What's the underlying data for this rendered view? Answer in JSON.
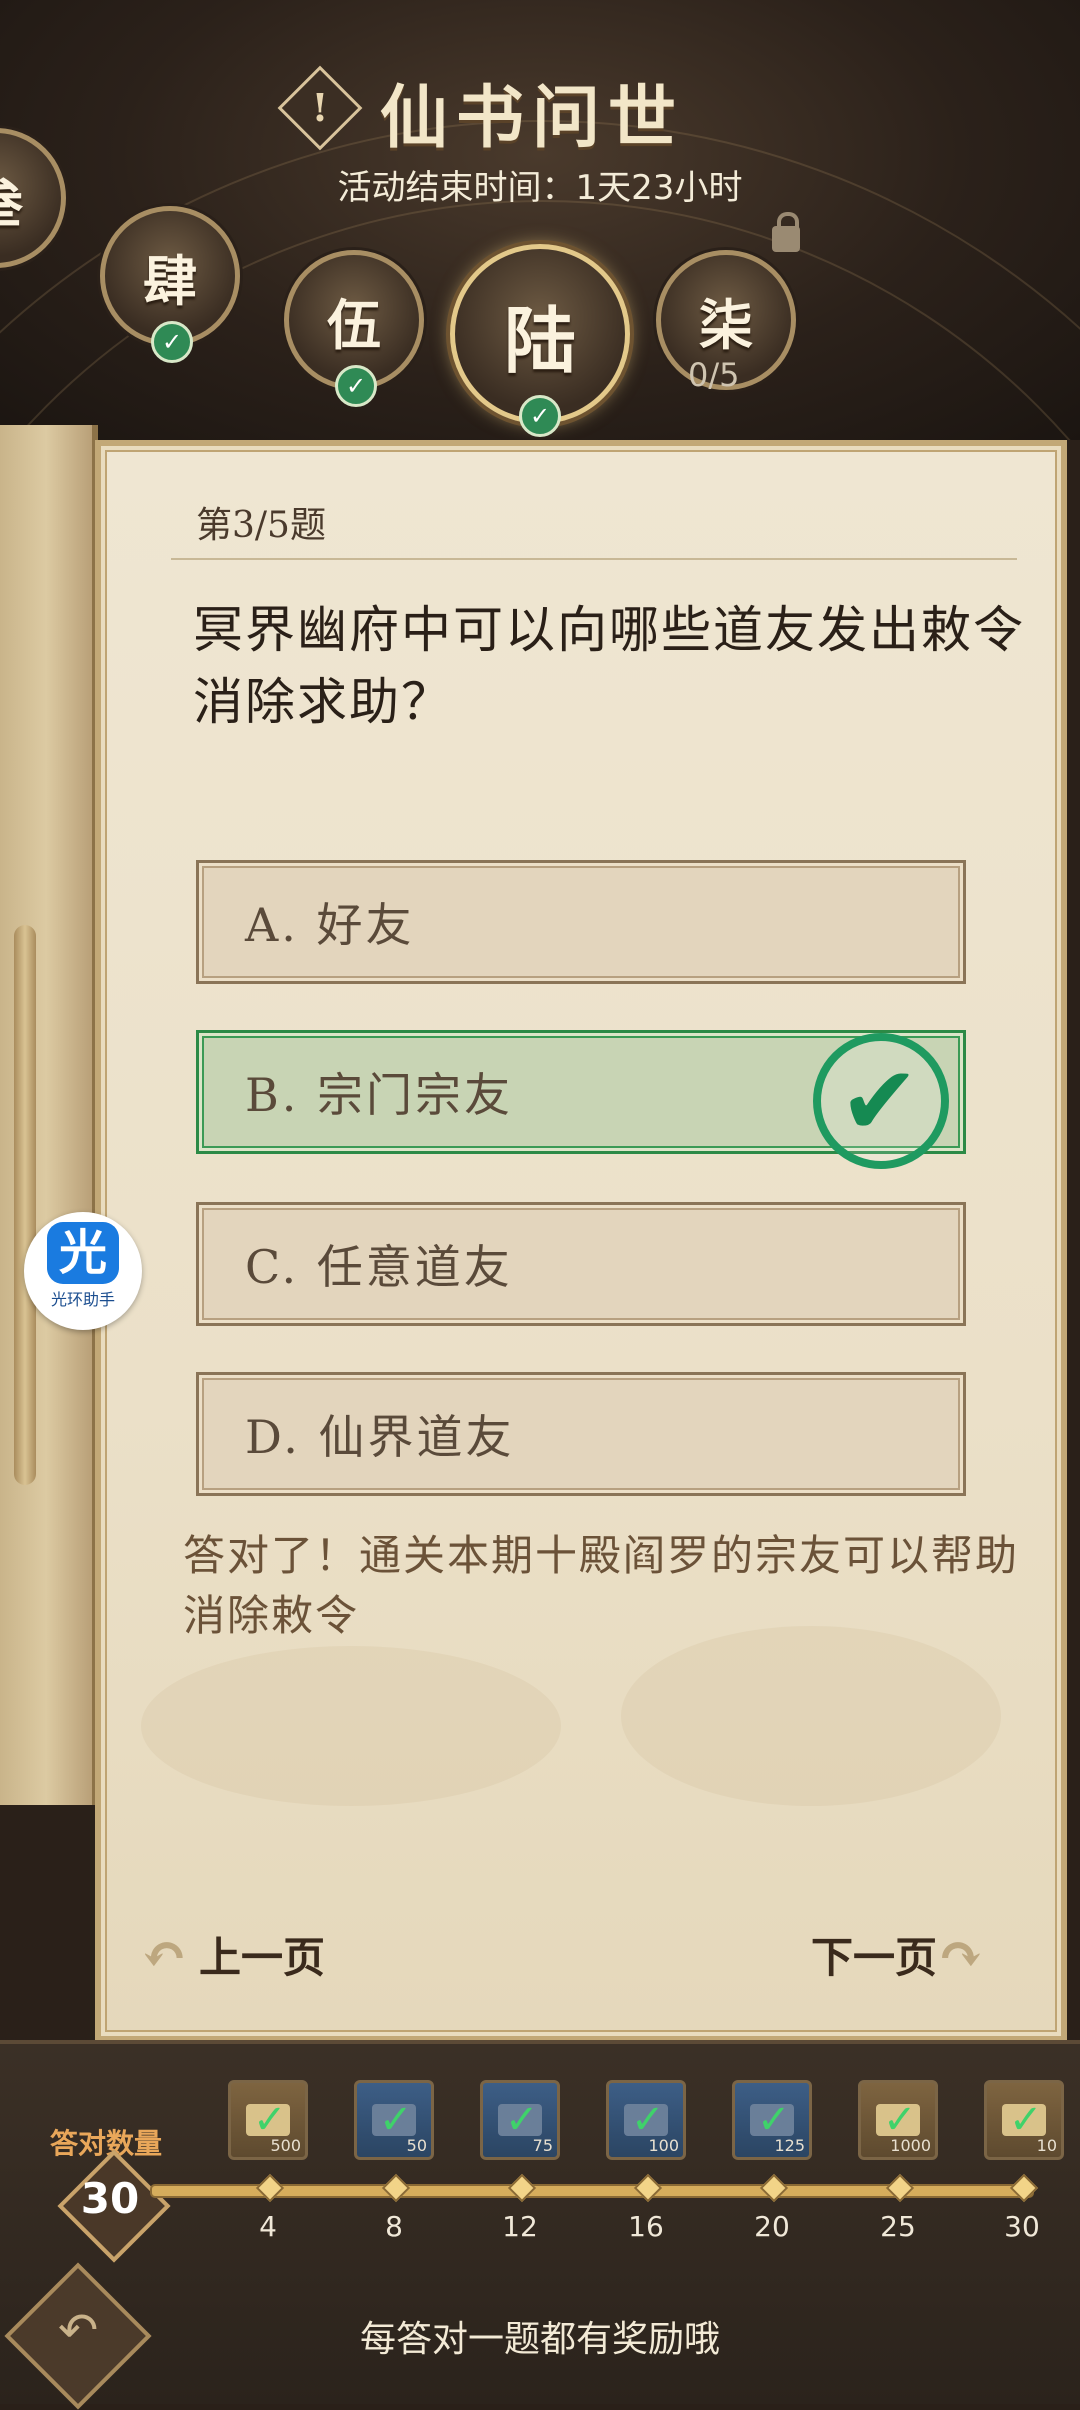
{
  "header": {
    "title": "仙书问世",
    "end_time_label": "活动结束时间：",
    "end_time_value": "1天23小时",
    "chapters": [
      {
        "label": "叁",
        "status": "completed"
      },
      {
        "label": "肆",
        "status": "completed"
      },
      {
        "label": "伍",
        "status": "completed"
      },
      {
        "label": "陆",
        "status": "active-completed"
      },
      {
        "label": "柒",
        "status": "locked"
      }
    ],
    "locked_progress": "0/5",
    "alert_icon_text": "!"
  },
  "question": {
    "number": "第3/5题",
    "text": "冥界幽府中可以向哪些道友发出敕令消除求助？",
    "options": [
      {
        "label": "A. 好友",
        "state": "normal"
      },
      {
        "label": "B. 宗门宗友",
        "state": "correct"
      },
      {
        "label": "C. 任意道友",
        "state": "normal"
      },
      {
        "label": "D. 仙界道友",
        "state": "normal"
      }
    ],
    "explanation": "答对了！通关本期十殿阎罗的宗友可以帮助消除敕令"
  },
  "pager": {
    "prev": "上一页",
    "next": "下一页"
  },
  "helper": {
    "icon_text": "光",
    "label": "光环助手"
  },
  "rewards": {
    "count_label": "答对数量",
    "count_value": "30",
    "items": [
      {
        "quantity": "500",
        "style": "gold"
      },
      {
        "quantity": "50",
        "style": "blue"
      },
      {
        "quantity": "75",
        "style": "blue"
      },
      {
        "quantity": "100",
        "style": "blue"
      },
      {
        "quantity": "125",
        "style": "blue"
      },
      {
        "quantity": "1000",
        "style": "gold"
      },
      {
        "quantity": "10",
        "style": "gold"
      }
    ],
    "milestones": [
      "4",
      "8",
      "12",
      "16",
      "20",
      "25",
      "30"
    ],
    "hint": "每答对一题都有奖励哦"
  },
  "colors": {
    "correct_green": "#1f9a60",
    "scroll_bg": "#efe6d2",
    "header_bg": "#2b211a"
  }
}
